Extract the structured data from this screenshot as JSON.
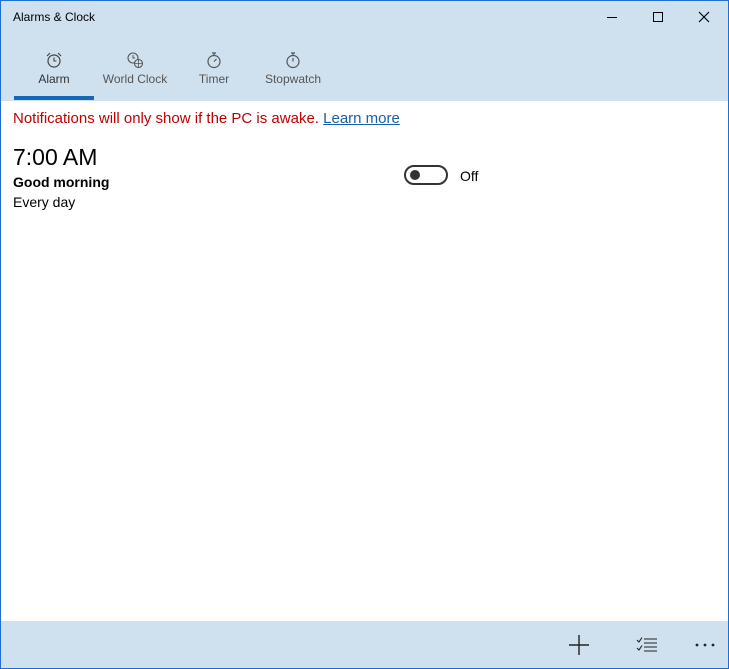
{
  "window": {
    "title": "Alarms & Clock"
  },
  "tabs": [
    {
      "label": "Alarm",
      "icon": "alarm-clock-icon",
      "active": true
    },
    {
      "label": "World Clock",
      "icon": "world-clock-icon",
      "active": false
    },
    {
      "label": "Timer",
      "icon": "timer-icon",
      "active": false
    },
    {
      "label": "Stopwatch",
      "icon": "stopwatch-icon",
      "active": false
    }
  ],
  "notice": {
    "text": "Notifications will only show if the PC is awake.",
    "link": "Learn more"
  },
  "alarms": [
    {
      "time": "7:00 AM",
      "name": "Good morning",
      "repeat": "Every day",
      "toggle_state": "Off"
    }
  ],
  "footer": {
    "buttons": [
      "add-icon",
      "select-list-icon",
      "more-icon"
    ]
  },
  "colors": {
    "header_bg": "#cfe0ef",
    "accent": "#1568b8",
    "notice_text": "#c00000",
    "link": "#1a5fa6"
  }
}
